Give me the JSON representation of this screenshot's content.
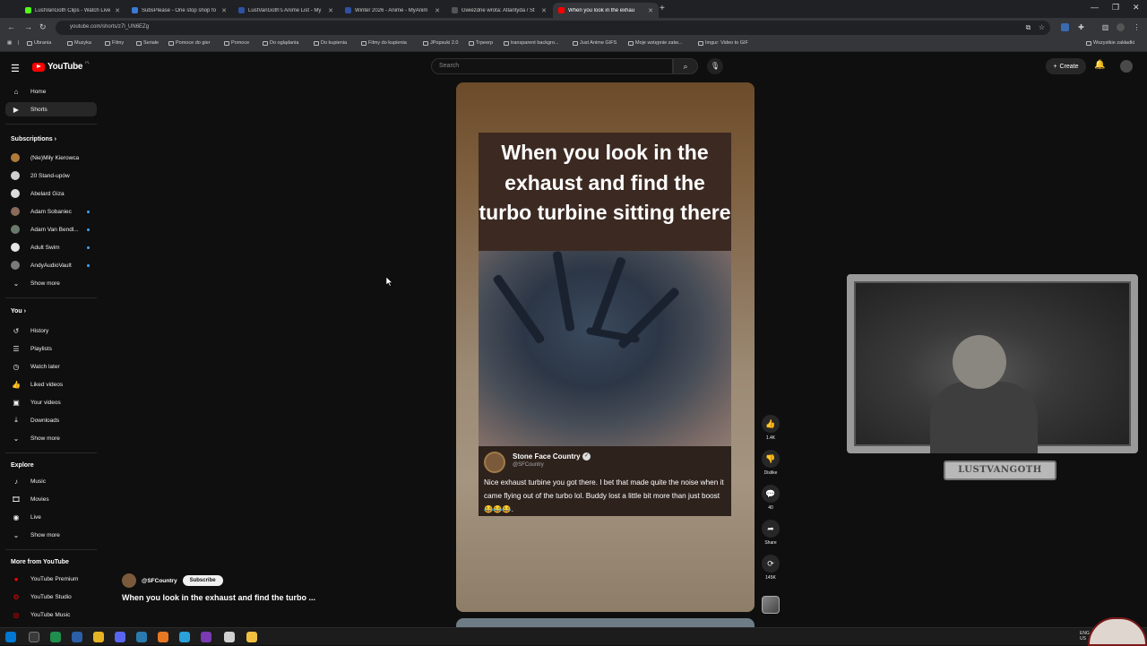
{
  "browser": {
    "tabs": [
      {
        "label": "LustVanGoth Clips - Watch Live",
        "color": "#53fc18"
      },
      {
        "label": "SubsPlease - One stop shop fo",
        "color": "#3a7bd5"
      },
      {
        "label": "LustVanGoth's Anime List - My",
        "color": "#2e51a2"
      },
      {
        "label": "Winter 2026 - Anime - MyAnim",
        "color": "#2e51a2"
      },
      {
        "label": "Gwiezdne wrota: Atlantyda / St",
        "color": "#555555"
      },
      {
        "label": "When you look in the exhau",
        "color": "#ff0000"
      }
    ],
    "new_tab": "+",
    "url": "youtube.com/shorts/z7l_UN6EZg",
    "bookmarks": [
      "Ubrania",
      "Muzyka",
      "Filmy",
      "Seriale",
      "Pomoce do gier",
      "Pomoce",
      "Do oglądania",
      "Do kupienia",
      "Filmy do kupienia",
      "JPopsuki 2.0",
      "Trpeerp",
      "transparent backgro...",
      "Just Anime GIFS",
      "Moje wstępnie zatw...",
      "Imgur: Video to GIF"
    ],
    "bookmarks_all": "Wszystkie zakładki"
  },
  "youtube": {
    "logo_text": "YouTube",
    "logo_country": "PL",
    "search_placeholder": "Search",
    "create_label": "Create",
    "sidebar": {
      "main": [
        {
          "label": "Home",
          "icon": "home-icon"
        },
        {
          "label": "Shorts",
          "icon": "shorts-icon"
        }
      ],
      "subscriptions_header": "Subscriptions",
      "subscriptions": [
        {
          "label": "(Nie)Miły Kierowca",
          "color": "#b07a3a",
          "dot": false
        },
        {
          "label": "20 Stand-upów",
          "color": "#cfcfcf",
          "dot": false
        },
        {
          "label": "Abelard Giza",
          "color": "#dcdcdc",
          "dot": false
        },
        {
          "label": "Adam Sobaniec",
          "color": "#8a6a5a",
          "dot": true
        },
        {
          "label": "Adam Van Bendl...",
          "color": "#6a7a6a",
          "dot": true
        },
        {
          "label": "Adult Swim",
          "color": "#e6e6e6",
          "dot": true
        },
        {
          "label": "AndyAudioVault",
          "color": "#7a7a7a",
          "dot": true
        }
      ],
      "show_more_1": "Show more",
      "you_header": "You",
      "you_items": [
        {
          "label": "History",
          "icon": "history-icon"
        },
        {
          "label": "Playlists",
          "icon": "playlists-icon"
        },
        {
          "label": "Watch later",
          "icon": "watch-later-icon"
        },
        {
          "label": "Liked videos",
          "icon": "liked-videos-icon"
        },
        {
          "label": "Your videos",
          "icon": "your-videos-icon"
        },
        {
          "label": "Downloads",
          "icon": "downloads-icon"
        }
      ],
      "show_more_2": "Show more",
      "explore_header": "Explore",
      "explore_items": [
        {
          "label": "Music",
          "icon": "music-icon"
        },
        {
          "label": "Movies",
          "icon": "movies-icon"
        },
        {
          "label": "Live",
          "icon": "live-icon"
        }
      ],
      "show_more_3": "Show more",
      "more_header": "More from YouTube",
      "more_items": [
        {
          "label": "YouTube Premium"
        },
        {
          "label": "YouTube Studio"
        },
        {
          "label": "YouTube Music"
        }
      ]
    },
    "short": {
      "caption": "When you look in the exhaust and find the turbo turbine sitting there",
      "comment_author": "Stone Face Country",
      "comment_handle": "@SFCountry",
      "comment_text": "Nice exhaust turbine you got there. I bet that made quite the noise when it came flying out of the turbo lol. Buddy lost a little bit more than just boost 😂😂😂.",
      "channel_handle": "@SFCountry",
      "subscribe_label": "Subscribe",
      "title": "When you look in the exhaust and find the turbo ..."
    },
    "actions": {
      "likes": "1.4K",
      "dislike": "Dislike",
      "comments": "40",
      "share": "Share",
      "remix": "145K"
    },
    "webcam_nameplate": "LUSTVANGOTH"
  },
  "taskbar": {
    "lang": "ENG\nUS"
  },
  "colors": {
    "youtube_red": "#ff0000",
    "background": "#0f0f0f",
    "subscription_dot": "#3ea6ff"
  }
}
